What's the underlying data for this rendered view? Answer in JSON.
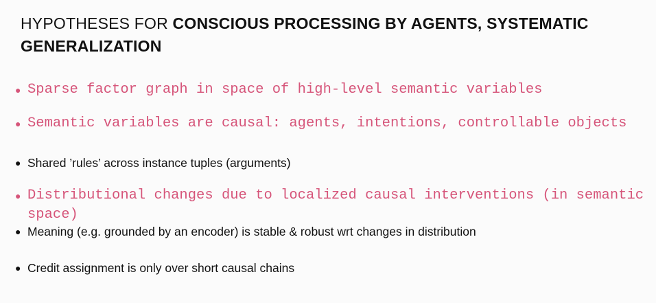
{
  "title": {
    "prefix": "HYPOTHESES FOR ",
    "emphasis": "CONSCIOUS PROCESSING BY AGENTS, SYSTEMATIC GENERALIZATION"
  },
  "bullets": [
    {
      "text": "Sparse factor graph in space of high-level semantic variables"
    },
    {
      "text": "Semantic variables are causal: agents, intentions, controllable objects"
    },
    {
      "text": "Shared ’rules’ across instance tuples (arguments)"
    },
    {
      "text": "Distributional changes due to localized causal interventions (in semantic space)"
    },
    {
      "text": "Meaning (e.g. grounded by an encoder) is stable & robust wrt changes in distribution"
    },
    {
      "text": "Credit assignment is only over short causal chains"
    }
  ],
  "colors": {
    "highlight": "#d6557a",
    "text": "#111111",
    "background": "#fbfbfb"
  }
}
